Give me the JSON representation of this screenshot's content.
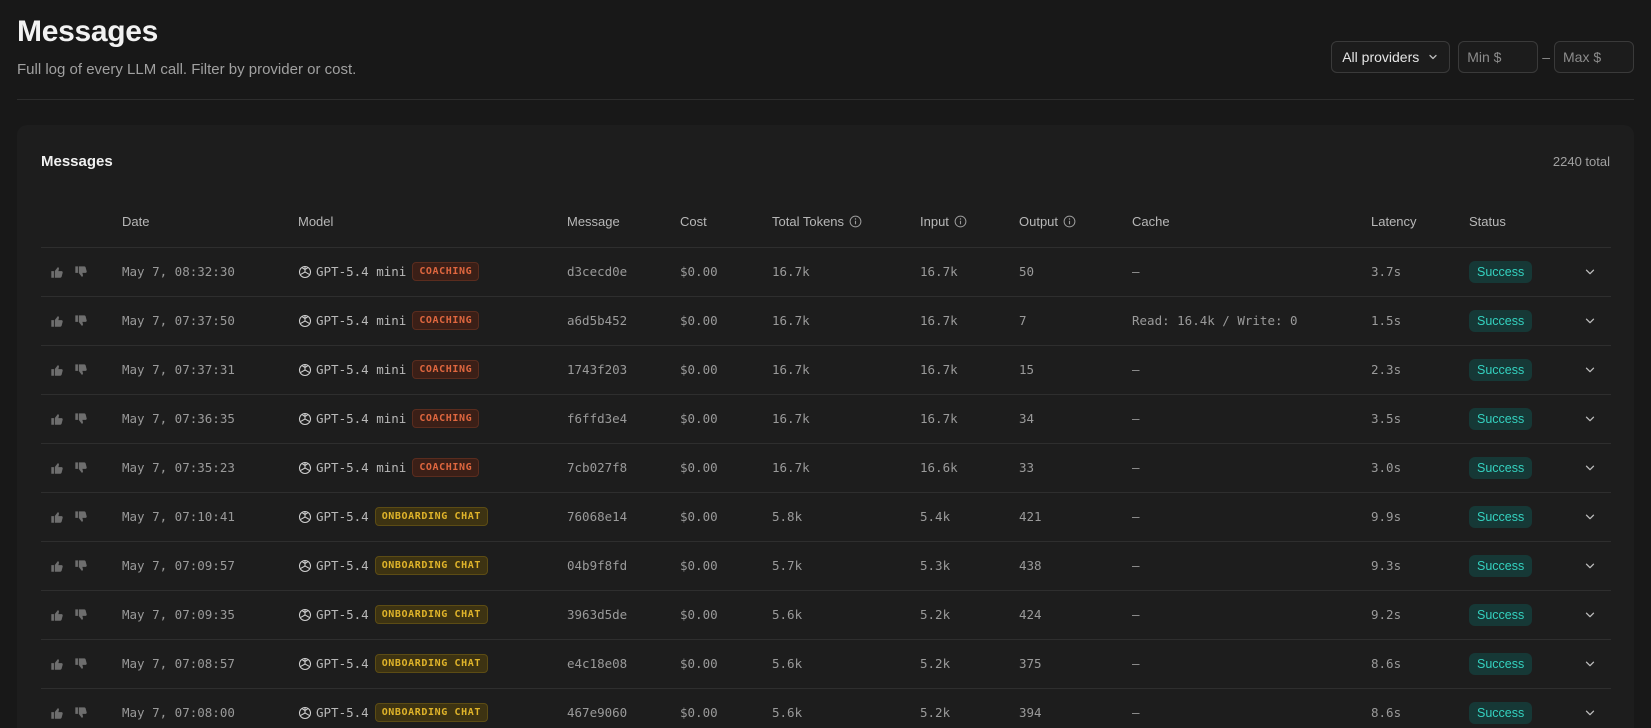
{
  "header": {
    "title": "Messages",
    "subtitle": "Full log of every LLM call. Filter by provider or cost.",
    "provider_select": "All providers",
    "min_placeholder": "Min $",
    "max_placeholder": "Max $",
    "range_separator": "–"
  },
  "card": {
    "title": "Messages",
    "total": "2240 total"
  },
  "columns": {
    "date": "Date",
    "model": "Model",
    "message": "Message",
    "cost": "Cost",
    "total_tokens": "Total Tokens",
    "input": "Input",
    "output": "Output",
    "cache": "Cache",
    "latency": "Latency",
    "status": "Status"
  },
  "rows": [
    {
      "date": "May 7, 08:32:30",
      "model": "GPT-5.4 mini",
      "tag": "COACHING",
      "tag_type": "coaching",
      "message": "d3cecd0e",
      "cost": "$0.00",
      "total": "16.7k",
      "input": "16.7k",
      "output": "50",
      "cache": "—",
      "latency": "3.7s",
      "status": "Success"
    },
    {
      "date": "May 7, 07:37:50",
      "model": "GPT-5.4 mini",
      "tag": "COACHING",
      "tag_type": "coaching",
      "message": "a6d5b452",
      "cost": "$0.00",
      "total": "16.7k",
      "input": "16.7k",
      "output": "7",
      "cache": "Read: 16.4k / Write: 0",
      "latency": "1.5s",
      "status": "Success"
    },
    {
      "date": "May 7, 07:37:31",
      "model": "GPT-5.4 mini",
      "tag": "COACHING",
      "tag_type": "coaching",
      "message": "1743f203",
      "cost": "$0.00",
      "total": "16.7k",
      "input": "16.7k",
      "output": "15",
      "cache": "—",
      "latency": "2.3s",
      "status": "Success"
    },
    {
      "date": "May 7, 07:36:35",
      "model": "GPT-5.4 mini",
      "tag": "COACHING",
      "tag_type": "coaching",
      "message": "f6ffd3e4",
      "cost": "$0.00",
      "total": "16.7k",
      "input": "16.7k",
      "output": "34",
      "cache": "—",
      "latency": "3.5s",
      "status": "Success"
    },
    {
      "date": "May 7, 07:35:23",
      "model": "GPT-5.4 mini",
      "tag": "COACHING",
      "tag_type": "coaching",
      "message": "7cb027f8",
      "cost": "$0.00",
      "total": "16.7k",
      "input": "16.6k",
      "output": "33",
      "cache": "—",
      "latency": "3.0s",
      "status": "Success"
    },
    {
      "date": "May 7, 07:10:41",
      "model": "GPT-5.4",
      "tag": "ONBOARDING CHAT",
      "tag_type": "onboarding",
      "message": "76068e14",
      "cost": "$0.00",
      "total": "5.8k",
      "input": "5.4k",
      "output": "421",
      "cache": "—",
      "latency": "9.9s",
      "status": "Success"
    },
    {
      "date": "May 7, 07:09:57",
      "model": "GPT-5.4",
      "tag": "ONBOARDING CHAT",
      "tag_type": "onboarding",
      "message": "04b9f8fd",
      "cost": "$0.00",
      "total": "5.7k",
      "input": "5.3k",
      "output": "438",
      "cache": "—",
      "latency": "9.3s",
      "status": "Success"
    },
    {
      "date": "May 7, 07:09:35",
      "model": "GPT-5.4",
      "tag": "ONBOARDING CHAT",
      "tag_type": "onboarding",
      "message": "3963d5de",
      "cost": "$0.00",
      "total": "5.6k",
      "input": "5.2k",
      "output": "424",
      "cache": "—",
      "latency": "9.2s",
      "status": "Success"
    },
    {
      "date": "May 7, 07:08:57",
      "model": "GPT-5.4",
      "tag": "ONBOARDING CHAT",
      "tag_type": "onboarding",
      "message": "e4c18e08",
      "cost": "$0.00",
      "total": "5.6k",
      "input": "5.2k",
      "output": "375",
      "cache": "—",
      "latency": "8.6s",
      "status": "Success"
    },
    {
      "date": "May 7, 07:08:00",
      "model": "GPT-5.4",
      "tag": "ONBOARDING CHAT",
      "tag_type": "onboarding",
      "message": "467e9060",
      "cost": "$0.00",
      "total": "5.6k",
      "input": "5.2k",
      "output": "394",
      "cache": "—",
      "latency": "8.6s",
      "status": "Success"
    }
  ],
  "colors": {
    "background": "#181818",
    "card": "#1d1d1d",
    "success": "#34d1bf",
    "coaching": "#e0673f",
    "onboarding": "#e0b42a"
  }
}
